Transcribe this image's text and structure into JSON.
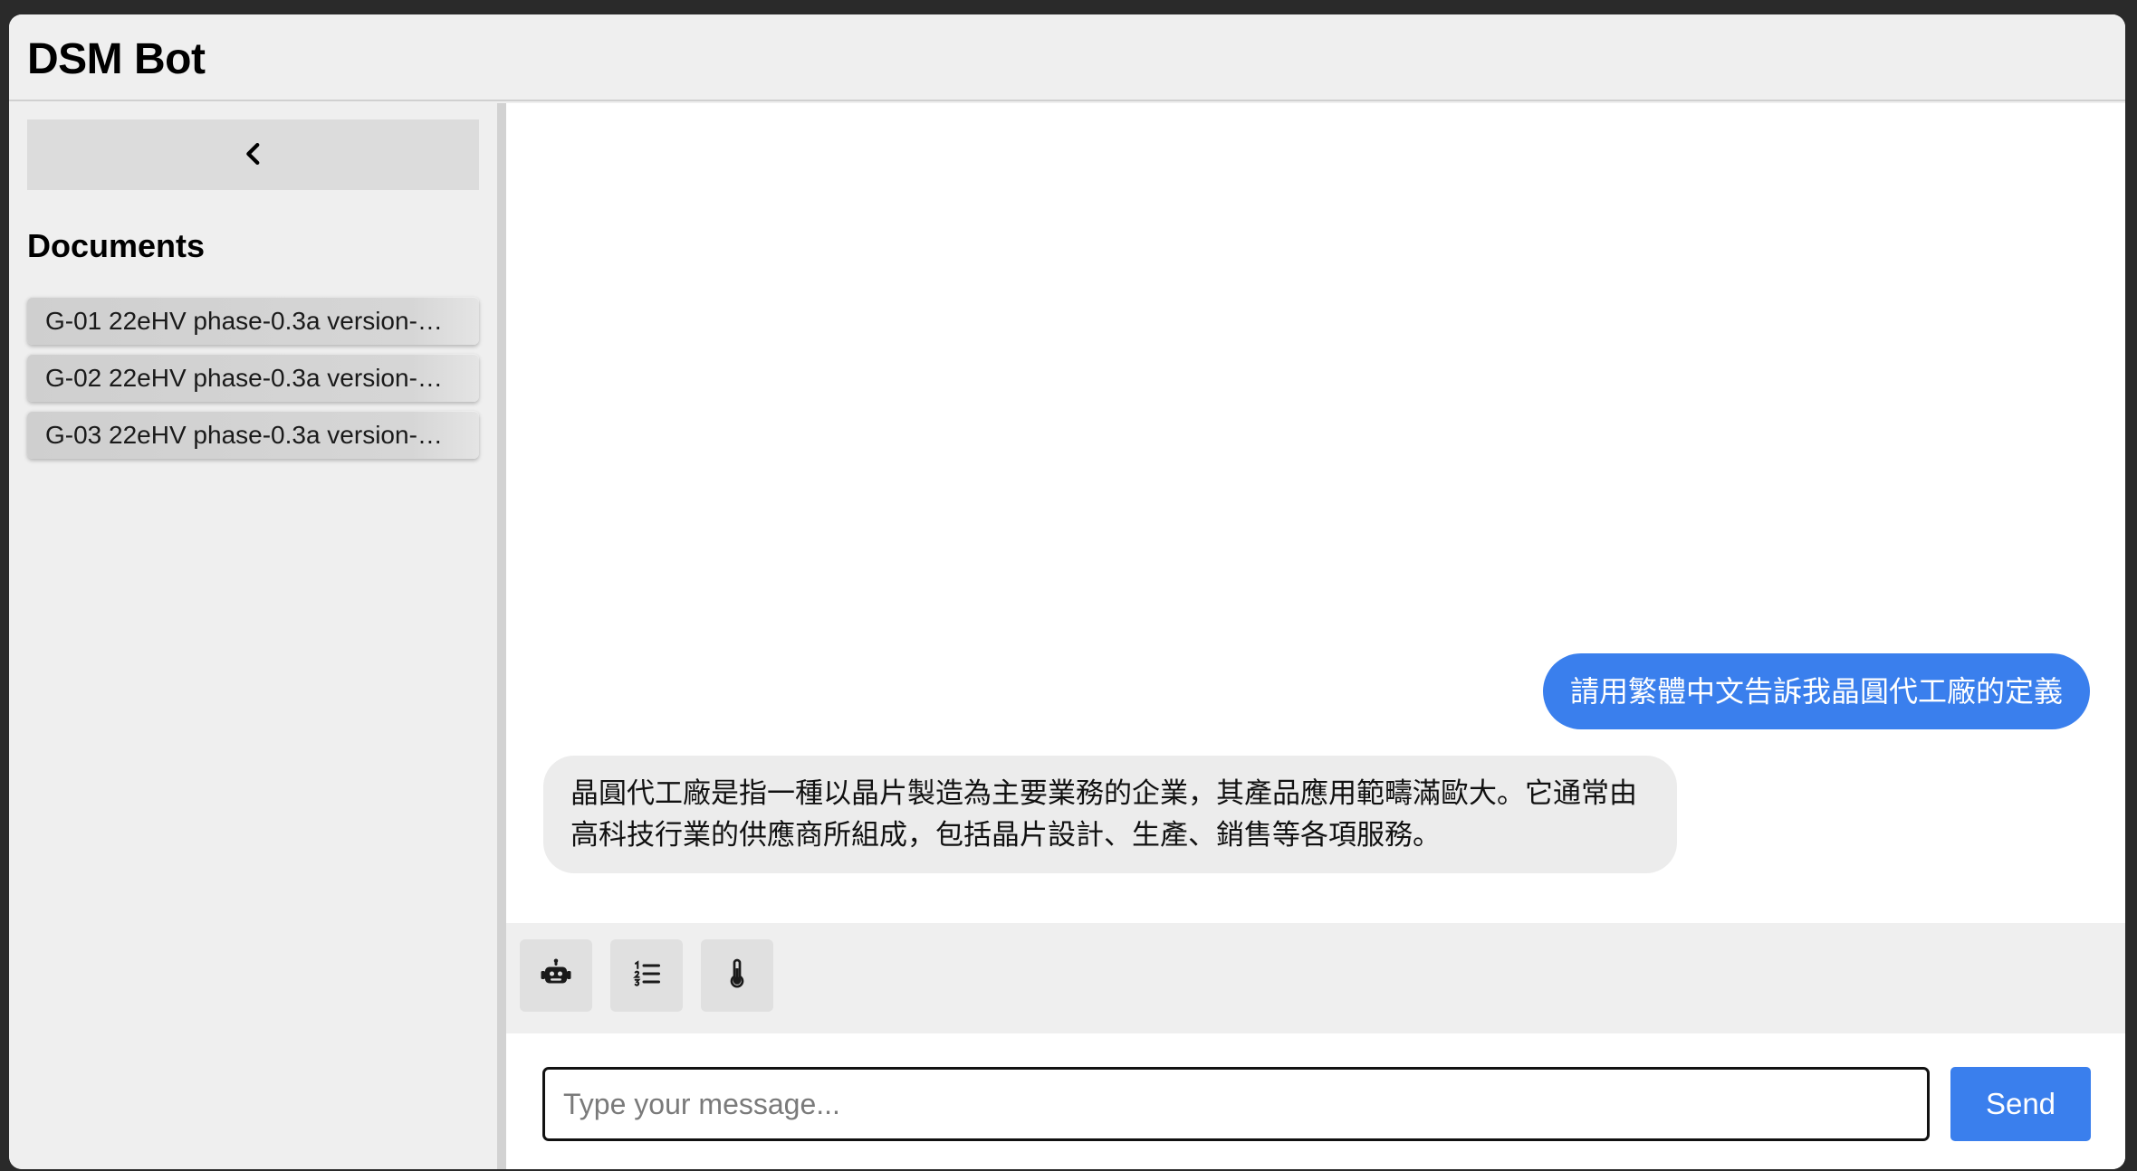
{
  "app": {
    "title": "DSM Bot"
  },
  "sidebar": {
    "collapse_icon": "chevron-left-icon",
    "documents_heading": "Documents",
    "documents": [
      {
        "label": "G-01 22eHV phase-0.3a version-…"
      },
      {
        "label": "G-02 22eHV phase-0.3a version-…"
      },
      {
        "label": "G-03 22eHV phase-0.3a version-…"
      }
    ]
  },
  "chat": {
    "messages": [
      {
        "role": "user",
        "text": "請用繁體中文告訴我晶圓代工廠的定義"
      },
      {
        "role": "bot",
        "text": "晶圓代工廠是指一種以晶片製造為主要業務的企業，其產品應用範疇滿歐大。它通常由高科技行業的供應商所組成，包括晶片設計、生產、銷售等各項服務。"
      }
    ]
  },
  "toolbar": {
    "buttons": [
      {
        "icon": "robot-icon"
      },
      {
        "icon": "numbered-list-icon"
      },
      {
        "icon": "thermometer-icon"
      }
    ]
  },
  "composer": {
    "placeholder": "Type your message...",
    "value": "",
    "send_label": "Send"
  },
  "colors": {
    "accent": "#3a7fed",
    "user_bubble": "#3a7fed",
    "bot_bubble": "#ececec",
    "panel_bg": "#efefef"
  }
}
